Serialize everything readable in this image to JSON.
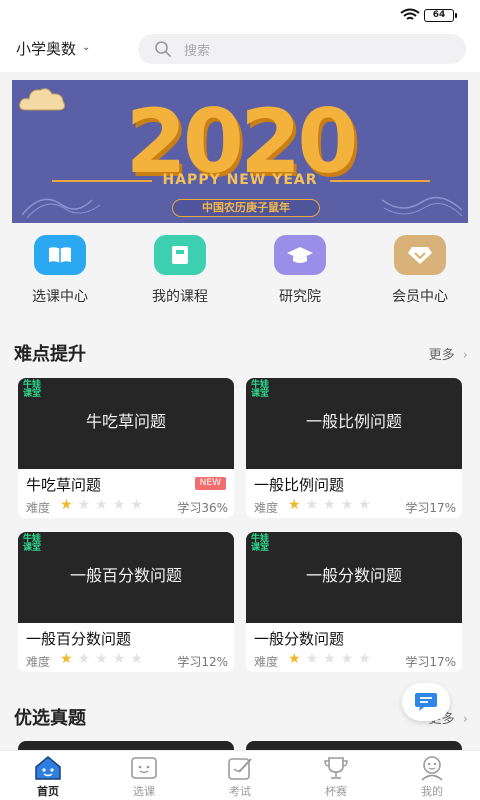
{
  "status_bar": {
    "battery": "64"
  },
  "header": {
    "subject": "小学奥数",
    "search_placeholder": "搜索"
  },
  "banner": {
    "year": "2020",
    "headline": "HAPPY NEW YEAR",
    "tag": "中国农历庚子鼠年"
  },
  "quick_links": [
    {
      "label": "选课中心",
      "icon": "book-icon",
      "color": "#2aa8f2"
    },
    {
      "label": "我的课程",
      "icon": "notebook-icon",
      "color": "#3ccfb0"
    },
    {
      "label": "研究院",
      "icon": "graduation-cap-icon",
      "color": "#9a8ee8"
    },
    {
      "label": "会员中心",
      "icon": "diamond-icon",
      "color": "#d9b27a"
    }
  ],
  "section1": {
    "title": "难点提升",
    "more": "更多"
  },
  "courses": [
    {
      "thumb_title": "牛吃草问题",
      "name": "牛吃草问题",
      "badge": "NEW",
      "difficulty_label": "难度",
      "rating": 1,
      "progress": "学习36%"
    },
    {
      "thumb_title": "一般比例问题",
      "name": "一般比例问题",
      "badge": "",
      "difficulty_label": "难度",
      "rating": 1,
      "progress": "学习17%"
    },
    {
      "thumb_title": "一般百分数问题",
      "name": "一般百分数问题",
      "badge": "",
      "difficulty_label": "难度",
      "rating": 1,
      "progress": "学习12%"
    },
    {
      "thumb_title": "一般分数问题",
      "name": "一般分数问题",
      "badge": "",
      "difficulty_label": "难度",
      "rating": 1,
      "progress": "学习17%"
    }
  ],
  "thumb_logo": "牛娃课堂",
  "section2": {
    "title": "优选真题",
    "more": "更多"
  },
  "tabs": [
    {
      "label": "首页",
      "icon": "home-icon",
      "active": true
    },
    {
      "label": "选课",
      "icon": "course-select-icon",
      "active": false
    },
    {
      "label": "考试",
      "icon": "exam-icon",
      "active": false
    },
    {
      "label": "杯赛",
      "icon": "trophy-icon",
      "active": false
    },
    {
      "label": "我的",
      "icon": "profile-icon",
      "active": false
    }
  ],
  "colors": {
    "accent": "#f0b92a",
    "banner_bg": "#5a5fa6",
    "badge_red": "#f26d6d"
  }
}
